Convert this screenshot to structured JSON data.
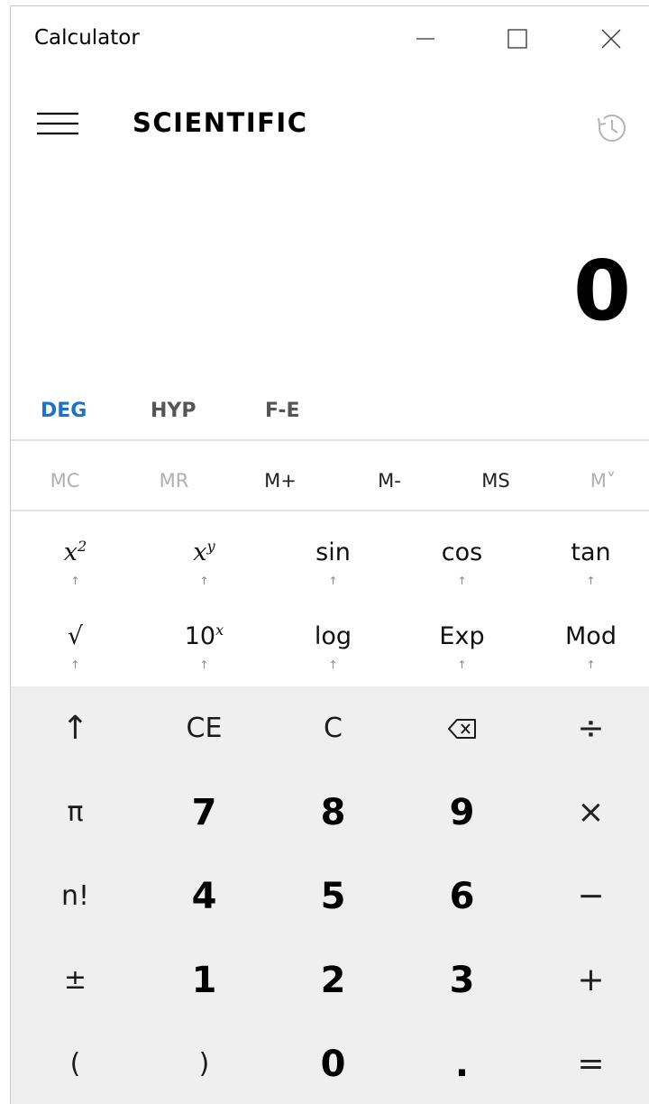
{
  "window": {
    "title": "Calculator",
    "controls": {
      "minimize": "minimize",
      "maximize": "maximize",
      "close": "close"
    }
  },
  "header": {
    "mode": "SCIENTIFIC",
    "menu_icon": "hamburger-menu-icon",
    "history_icon": "history-icon"
  },
  "display": {
    "value": "0"
  },
  "toggles": [
    {
      "label": "DEG",
      "active": true
    },
    {
      "label": "HYP",
      "active": false
    },
    {
      "label": "F-E",
      "active": false
    }
  ],
  "memory": [
    {
      "label": "MC",
      "enabled": false
    },
    {
      "label": "MR",
      "enabled": false
    },
    {
      "label": "M+",
      "enabled": true
    },
    {
      "label": "M-",
      "enabled": true
    },
    {
      "label": "MS",
      "enabled": true
    },
    {
      "label": "M˅",
      "enabled": false
    }
  ],
  "functions": {
    "row1": [
      {
        "name": "square",
        "base": "x",
        "sup": "2",
        "sub": "↑"
      },
      {
        "name": "power",
        "base": "x",
        "sup": "y",
        "sub": "↑"
      },
      {
        "name": "sin",
        "label": "sin",
        "sub": "↑"
      },
      {
        "name": "cos",
        "label": "cos",
        "sub": "↑"
      },
      {
        "name": "tan",
        "label": "tan",
        "sub": "↑"
      }
    ],
    "row2": [
      {
        "name": "sqrt",
        "label": "√",
        "sub": "↑"
      },
      {
        "name": "ten-power",
        "base": "10",
        "sup": "x",
        "sub": "↑"
      },
      {
        "name": "log",
        "label": "log",
        "sub": "↑"
      },
      {
        "name": "exp",
        "label": "Exp",
        "sub": "↑"
      },
      {
        "name": "mod",
        "label": "Mod",
        "sub": "↑"
      }
    ]
  },
  "keypad": {
    "row1": [
      "↑",
      "CE",
      "C",
      "⌫",
      "÷"
    ],
    "row2": [
      "π",
      "7",
      "8",
      "9",
      "×"
    ],
    "row3": [
      "n!",
      "4",
      "5",
      "6",
      "−"
    ],
    "row4": [
      "±",
      "1",
      "2",
      "3",
      "+"
    ],
    "row5": [
      "(",
      ")",
      "0",
      ".",
      "="
    ]
  },
  "colors": {
    "accent": "#1a73c8",
    "keypad_bg": "#efefef"
  }
}
